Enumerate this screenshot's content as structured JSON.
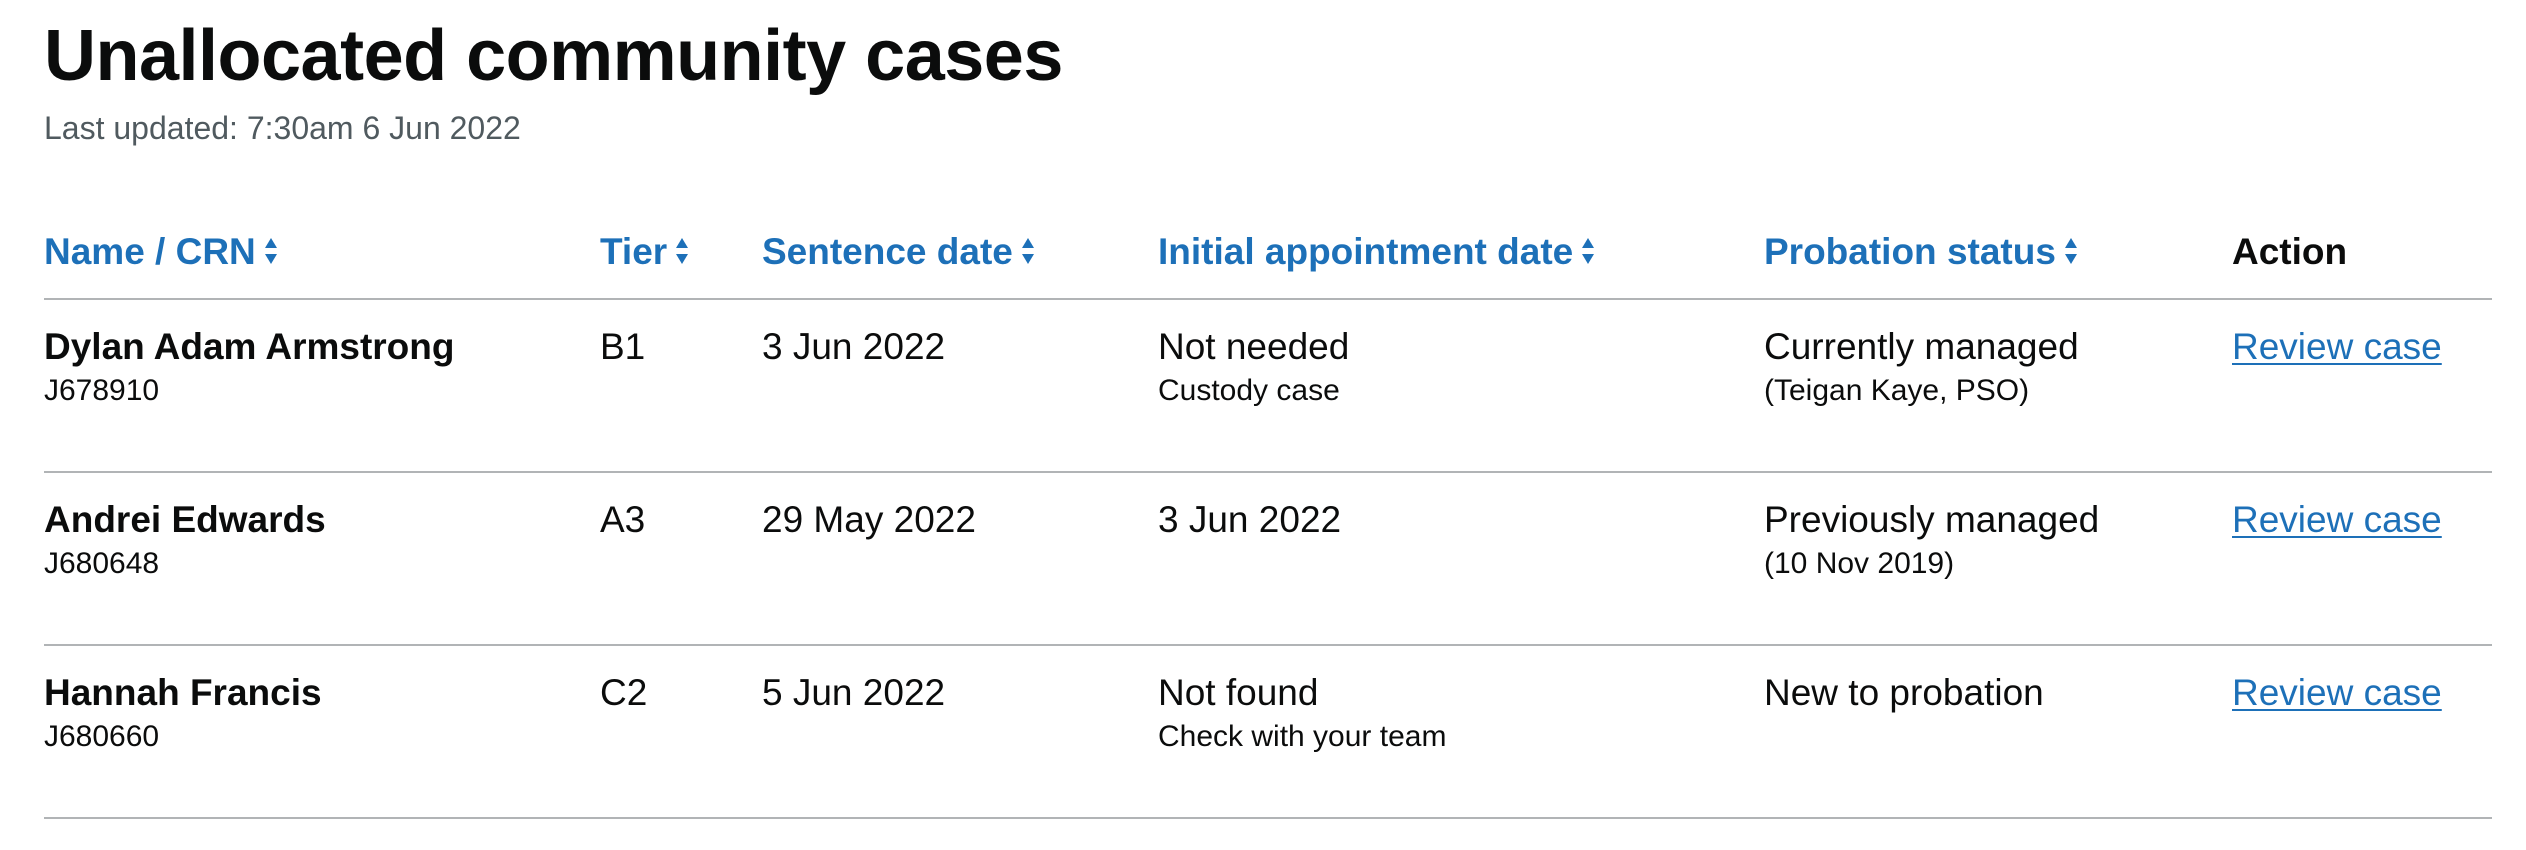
{
  "page": {
    "title": "Unallocated community cases",
    "last_updated": "Last updated: 7:30am 6 Jun 2022"
  },
  "table": {
    "headers": {
      "name": "Name / CRN",
      "tier": "Tier",
      "sentence_date": "Sentence date",
      "initial_appointment": "Initial appointment date",
      "probation_status": "Probation status",
      "action": "Action"
    },
    "rows": [
      {
        "name": "Dylan Adam Armstrong",
        "crn": "J678910",
        "tier": "B1",
        "sentence_date": "3 Jun 2022",
        "initial_appointment": "Not needed",
        "initial_appointment_note": "Custody case",
        "probation_status": "Currently managed",
        "probation_note": "(Teigan Kaye, PSO)",
        "action": "Review case"
      },
      {
        "name": "Andrei Edwards",
        "crn": "J680648",
        "tier": "A3",
        "sentence_date": "29 May 2022",
        "initial_appointment": "3 Jun 2022",
        "initial_appointment_note": "",
        "probation_status": "Previously managed",
        "probation_note": "(10 Nov 2019)",
        "action": "Review case"
      },
      {
        "name": "Hannah Francis",
        "crn": "J680660",
        "tier": "C2",
        "sentence_date": "5 Jun 2022",
        "initial_appointment": "Not found",
        "initial_appointment_note": "Check with your team",
        "probation_status": "New to probation",
        "probation_note": "",
        "action": "Review case"
      }
    ]
  },
  "icons": {
    "sort": "sort-arrows-icon"
  },
  "colors": {
    "link": "#1d70b8",
    "text": "#0b0c0c",
    "secondary_text": "#505a5f",
    "border": "#b1b4b6"
  }
}
